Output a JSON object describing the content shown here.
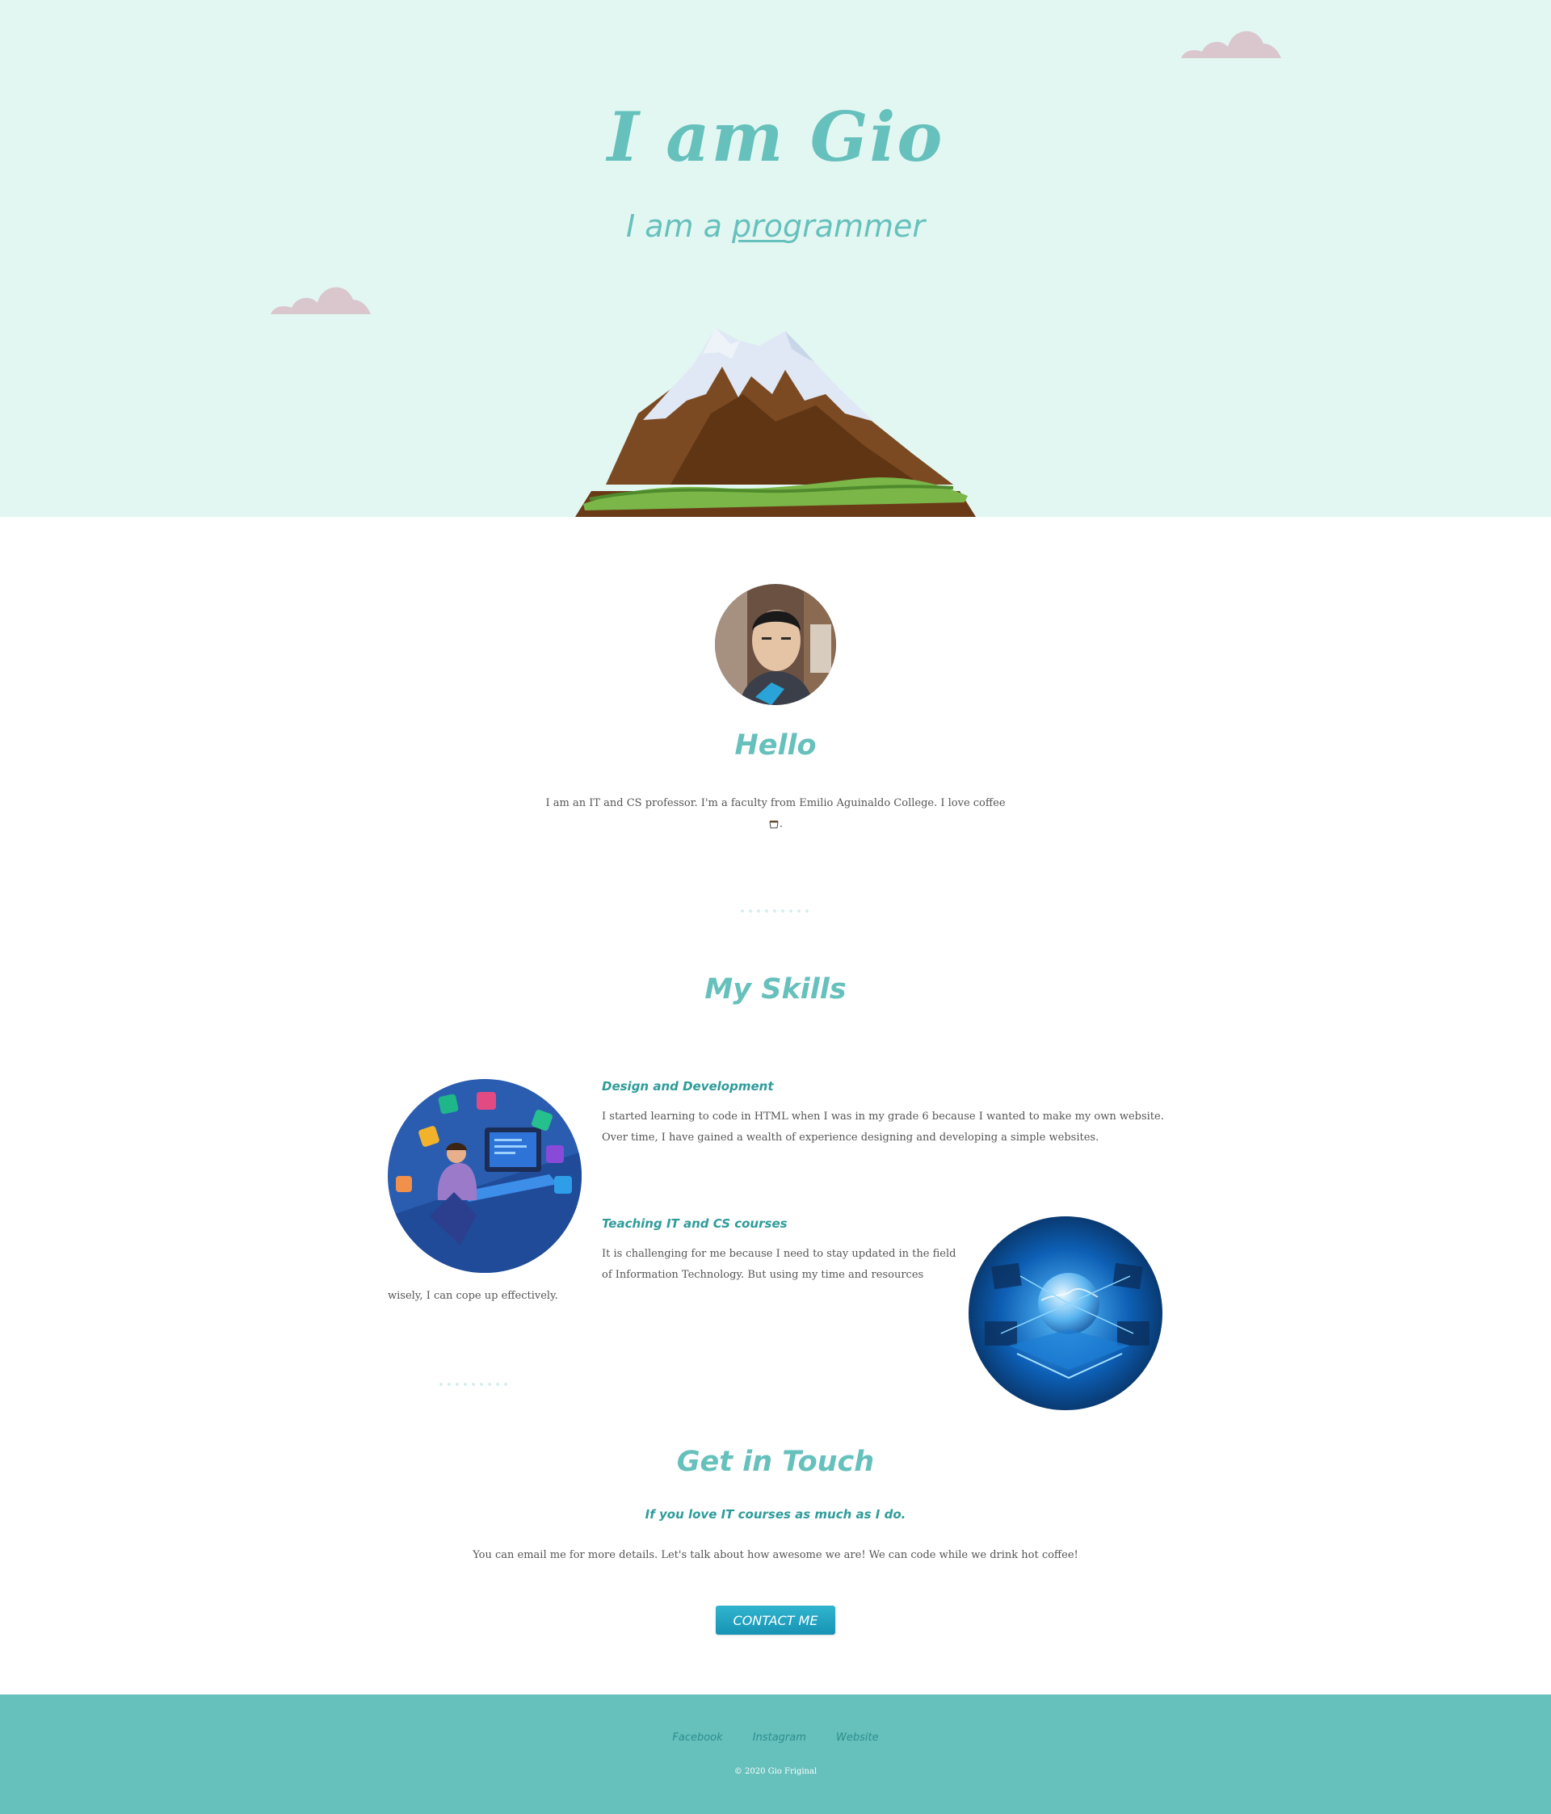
{
  "hero": {
    "title": "I am Gio",
    "subtitle_prefix": "I am a ",
    "subtitle_word": "programmer"
  },
  "about": {
    "title": "Hello",
    "text": "I am an IT and CS professor. I'm a faculty from Emilio Aguinaldo College. I love coffee",
    "text_end": "."
  },
  "skills": {
    "title": "My Skills",
    "items": [
      {
        "heading": "Design and Development",
        "text": "I started learning to code in HTML when I was in my grade 6 because I wanted to make my own website. Over time, I have gained a wealth of experience designing and developing a simple websites."
      },
      {
        "heading": "Teaching IT and CS courses",
        "text": "It is challenging for me because I need to stay updated in the field of Information Technology. But using my time and resources",
        "text_wrap": "wisely, I can cope up effectively."
      }
    ]
  },
  "contact": {
    "title": "Get in Touch",
    "tagline": "If you love IT courses as much as I do.",
    "text": "You can email me for more details. Let's talk about how awesome we are! We can code while we drink hot coffee!",
    "button_label": "CONTACT ME"
  },
  "footer": {
    "links": [
      "Facebook",
      "Instagram",
      "Website"
    ],
    "copyright": "© 2020 Gio Friginal"
  },
  "colors": {
    "hero_bg": "#e3f7f2",
    "accent": "#66c0bc",
    "heading_dark": "#2e9c9a",
    "button": "#1fa2c2",
    "footer_bg": "#66c0bc"
  },
  "icons": [
    "cloud-icon",
    "mountain-illustration",
    "coffee-cup-icon"
  ]
}
